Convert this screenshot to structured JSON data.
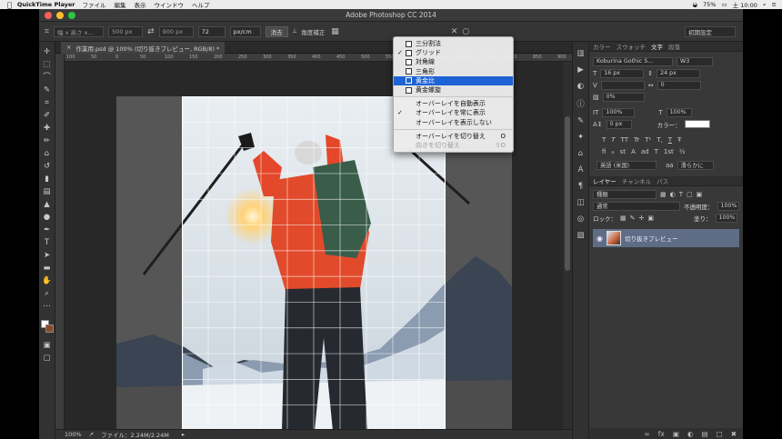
{
  "os_menubar": {
    "app_name": "QuickTime Player",
    "menus": [
      "ファイル",
      "編集",
      "表示",
      "ウインドウ",
      "ヘルプ"
    ],
    "battery": "75%",
    "time": "土 10:00"
  },
  "window": {
    "title": "Adobe Photoshop CC 2014"
  },
  "options_bar": {
    "ratio": "幅 x 高さ x...",
    "width": "500 px",
    "height": "900 px",
    "resolution": "72",
    "unit": "px/cm",
    "clear": "消去",
    "straighten": "角度補正",
    "workspace": "初期設定"
  },
  "document": {
    "tab_title": "作業用.psd @ 100% (切り抜きプレビュー, RGB/8) *",
    "zoom": "100%",
    "file_info": "ファイル：2.24M/2.24M"
  },
  "ruler": {
    "ticks": [
      "100",
      "50",
      "0",
      "50",
      "100",
      "150",
      "200",
      "250",
      "300",
      "350",
      "400",
      "450",
      "500",
      "550",
      "600",
      "650",
      "700",
      "750",
      "800",
      "850",
      "900"
    ]
  },
  "overlay_menu": {
    "items": [
      {
        "label": "三分割法",
        "checked": false,
        "selected": false
      },
      {
        "label": "グリッド",
        "checked": true,
        "selected": false
      },
      {
        "label": "対角線",
        "checked": false,
        "selected": false
      },
      {
        "label": "三角形",
        "checked": false,
        "selected": false
      },
      {
        "label": "黄金比",
        "checked": false,
        "selected": true
      },
      {
        "label": "黄金螺旋",
        "checked": false,
        "selected": false
      }
    ],
    "display_items": [
      {
        "label": "オーバーレイを自動表示",
        "checked": false
      },
      {
        "label": "オーバーレイを常に表示",
        "checked": true
      },
      {
        "label": "オーバーレイを表示しない",
        "checked": false
      }
    ],
    "cycle": {
      "label": "オーバーレイを切り替え",
      "shortcut": "O"
    },
    "orientation": {
      "label": "向きを切り替え",
      "shortcut": "⇧O"
    }
  },
  "character_panel": {
    "tabs": [
      "カラー",
      "スウォッチ",
      "文字",
      "段落"
    ],
    "active_tab": "文字",
    "font_family": "Koburina Gothic S...",
    "font_style": "W3",
    "font_size": "16 px",
    "leading": "24 px",
    "kerning": "",
    "tracking": "0",
    "tsume": "0%",
    "vertical_scale": "100%",
    "horizontal_scale": "100%",
    "baseline": "0 px",
    "color_label": "カラー：",
    "color": "#ffffff",
    "style_buttons": [
      "T",
      "T",
      "TT",
      "Tr",
      "T¹",
      "T,",
      "T",
      "Ŧ"
    ],
    "opentype_buttons": [
      "fi",
      "ℴ",
      "st",
      "A",
      "ad",
      "T",
      "1st",
      "½"
    ],
    "language": "英語 (米国)",
    "antialias": "滑らかに"
  },
  "layers_panel": {
    "tabs": [
      "レイヤー",
      "チャンネル",
      "パス"
    ],
    "filter": "種類",
    "blend_mode": "通常",
    "opacity_label": "不透明度：",
    "opacity": "100%",
    "lock_label": "ロック：",
    "fill_label": "塗り：",
    "fill": "100%",
    "layers": [
      {
        "name": "切り抜きプレビュー",
        "visible": true
      }
    ]
  }
}
